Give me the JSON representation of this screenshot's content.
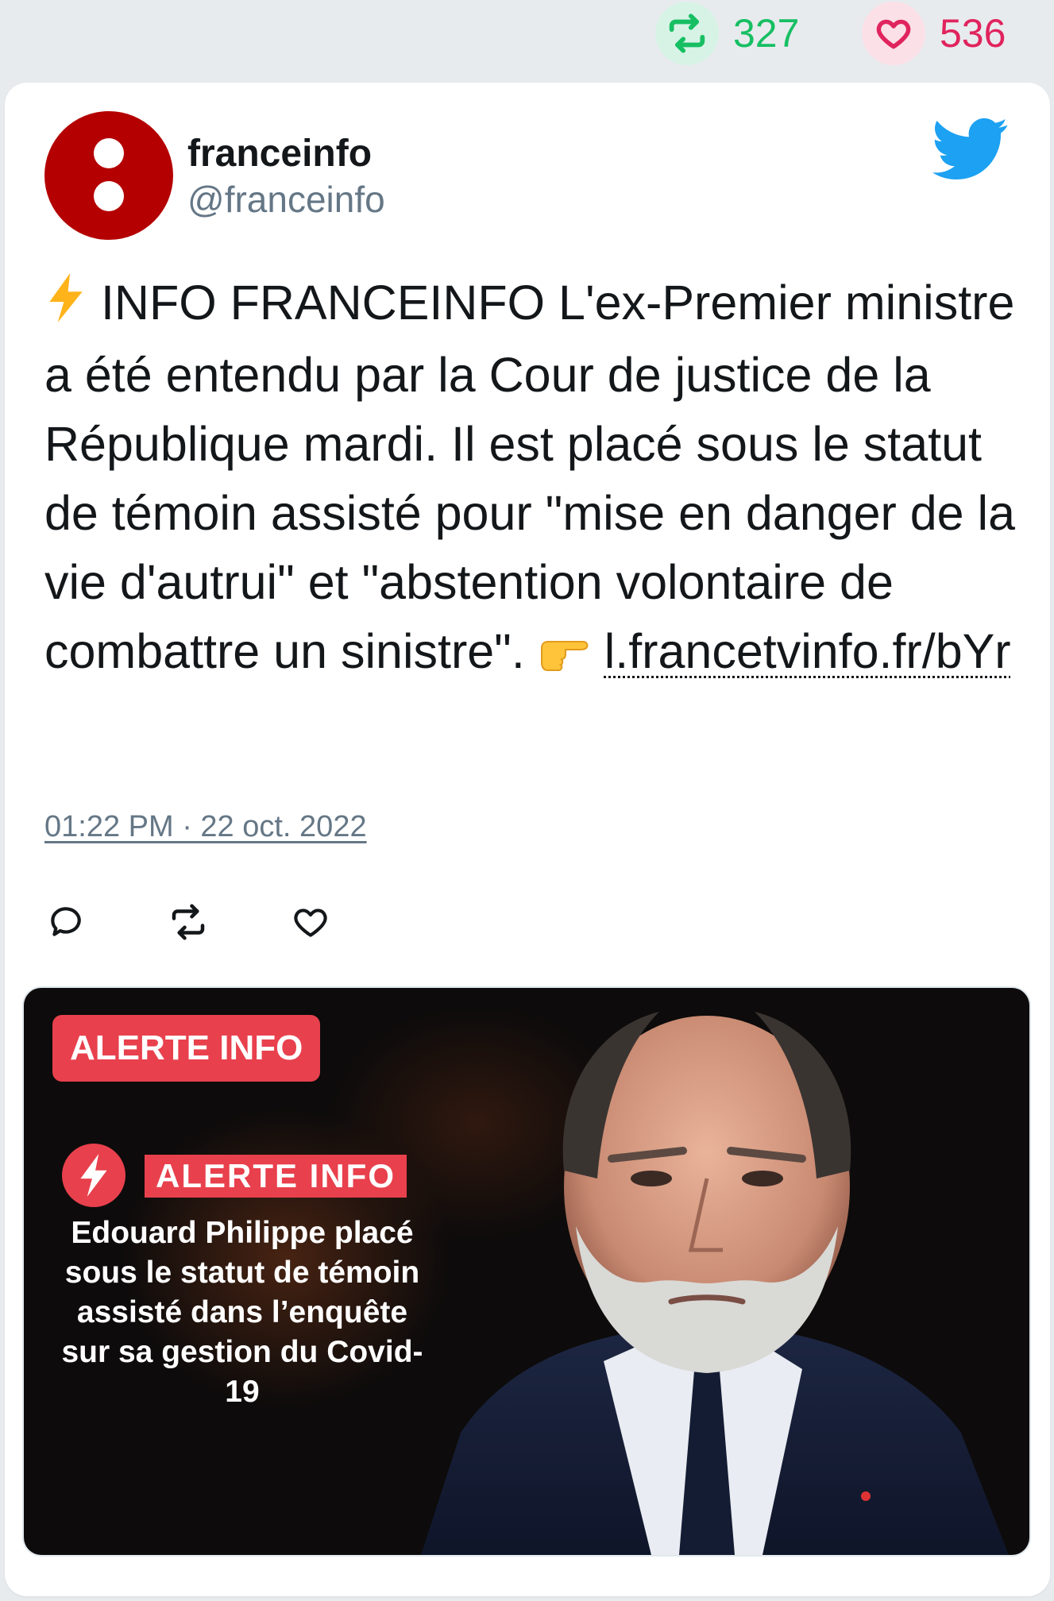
{
  "stats": {
    "retweets": "327",
    "likes": "536",
    "colors": {
      "retweet": "#17bf63",
      "like": "#e0245e"
    }
  },
  "tweet": {
    "display_name": "franceinfo",
    "handle": "@franceinfo",
    "text_emoji_start": "⚡",
    "text": "INFO FRANCEINFO L'ex-Premier ministre a été entendu par la Cour de justice de la République mardi. Il est placé sous le statut de témoin assisté pour \"mise en danger de la vie d'autrui\" et \"abstention volontaire de combattre un sinistre\".",
    "text_emoji_end": "👉",
    "link": "l.francetvinfo.fr/bYr",
    "timestamp": "01:22 PM · 22 oct. 2022"
  },
  "icons": [
    "retweet-icon",
    "heart-icon",
    "twitter-bird-icon",
    "reply-icon",
    "lightning-icon"
  ],
  "media": {
    "badge": "ALERTE INFO",
    "band": "ALERTE INFO",
    "headline": "Edouard Philippe placé sous le statut de témoin assisté dans l’enquête sur sa gestion du Covid-19"
  }
}
